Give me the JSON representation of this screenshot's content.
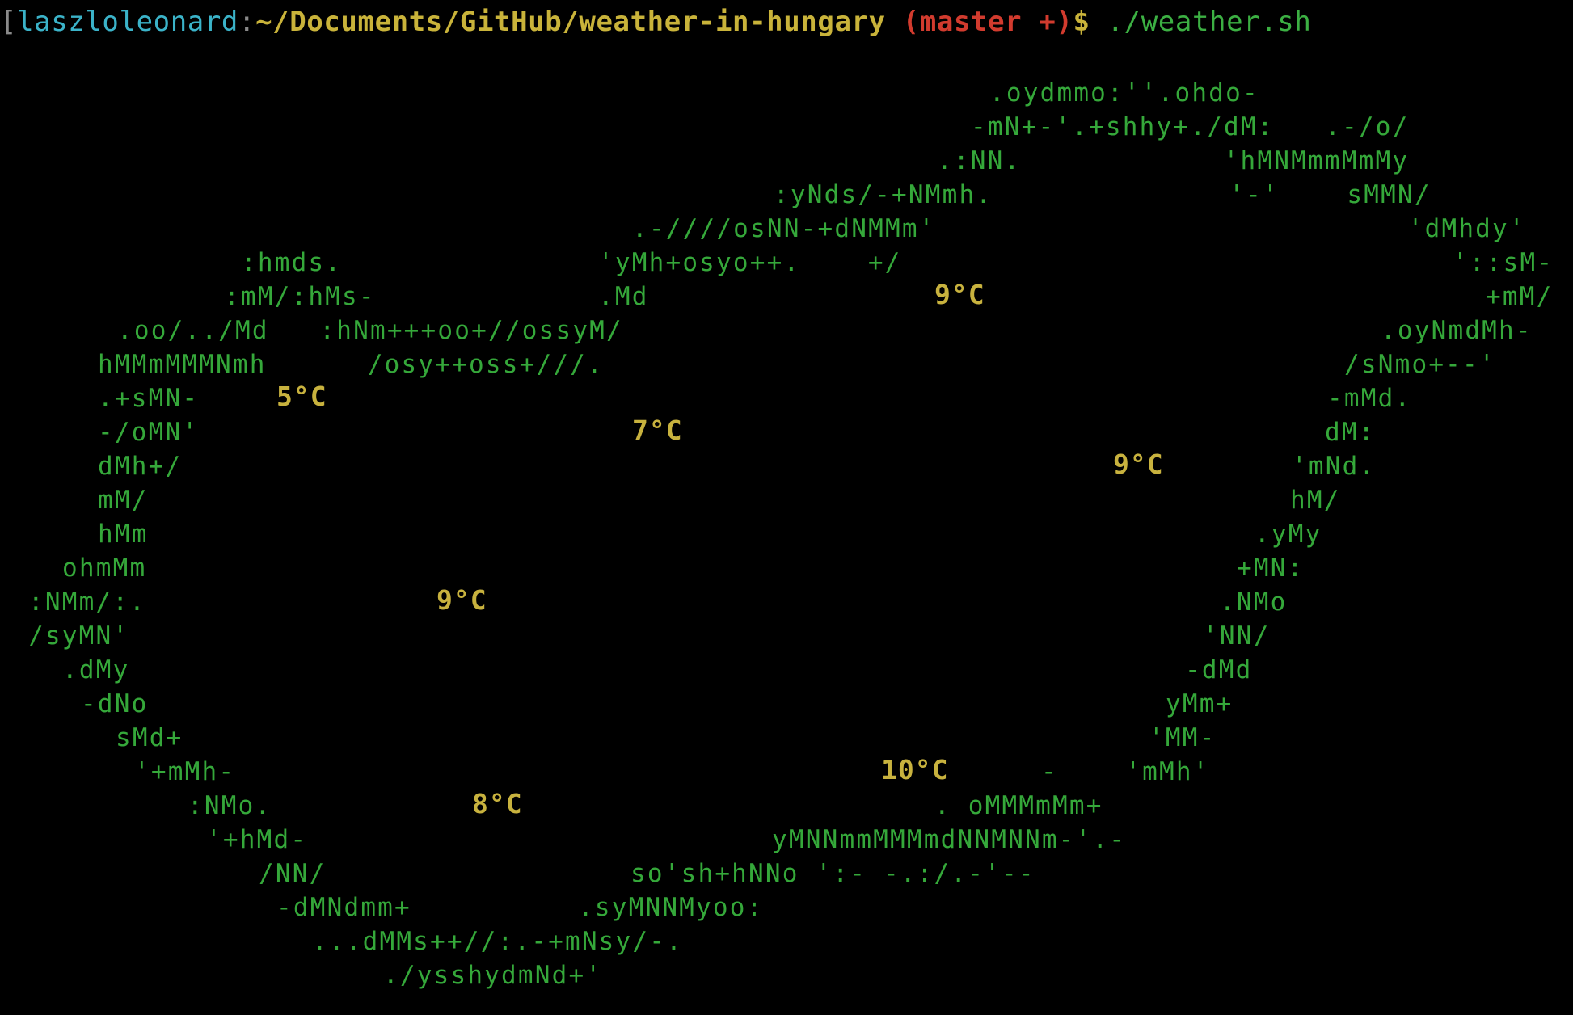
{
  "prompt": {
    "bracket": "[",
    "user": "laszloleonard",
    "colon": ":",
    "path": "~/Documents/GitHub/weather-in-hungary",
    "git_branch": " (master +)",
    "dollar": "$",
    "command": " ./weather.sh"
  },
  "colors": {
    "background": "#000000",
    "art": "#35a83a",
    "temperature": "#c8b23e",
    "user": "#3bb3c9",
    "path": "#c9b33a",
    "git": "#d23b2e"
  },
  "art_lines": [
    ".oydmmo:''.ohdo-",
    "-mN+-'.+shhy+./dM:   .-/o/",
    ".:NN.            'hMNMmmMmMy",
    ":yNds/-+NMmh.              '-'    sMMN/",
    ".-////osNN-+dNMMm'                            'dMhdy'",
    ":hmds.",
    "'yMh+osyo++.    +/",
    "'::sM-",
    ":mM/:hMs-",
    ".Md",
    "+mM/",
    ".oo/../Md   :hNm+++oo+//ossyM/",
    ".oyNmdMh-",
    "hMMmMMMNmh      /osy++oss+///.",
    "/sNmo+--'",
    ".+sMN-",
    "-mMd.",
    "-/oMN'",
    "dM:",
    "dMh+/",
    "'mNd.",
    "mM/",
    "hM/",
    "hMm",
    ".yMy",
    "ohmMm",
    "+MN:",
    ":NMm/:.",
    ".NMo",
    "/syMN'",
    "'NN/",
    ".dMy",
    "-dMd",
    "-dNo",
    "yMm+",
    "sMd+",
    "'MM-",
    "'+mMh-",
    "-    'mMh'",
    ":NMo.",
    ". oMMMmMm+",
    "'+hMd-",
    "yMNNmmMMMmdNNMNNm-'.-",
    "/NN/",
    "so'sh+hNNo ':- -.:/.-'--",
    "-dMNdmm+",
    ".syMNNMyoo:",
    "...dMMs++//:.-+mNsy/-.",
    "./ysshydmNd+'"
  ],
  "temperatures": [
    "9°C",
    "5°C",
    "7°C",
    "9°C",
    "9°C",
    "10°C",
    "8°C"
  ]
}
